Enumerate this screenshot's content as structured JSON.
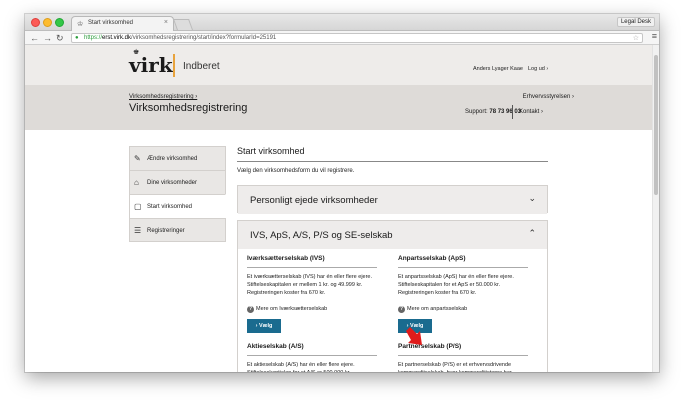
{
  "browser": {
    "tab_title": "Start virksomhed",
    "profile": "Legal Desk",
    "url_https": "https://",
    "url_host": "erst.virk.dk",
    "url_path": "/virksomhedsregistrering/start/index?formularId=25191"
  },
  "header": {
    "logo": "virk",
    "section": "Indberet",
    "user": "Anders Lyager Kaae",
    "logout": "Log ud ›"
  },
  "subheader": {
    "breadcrumb": "Virksomhedsregistrering ›",
    "title": "Virksomhedsregistrering",
    "agency": "Erhvervsstyrelsen ›",
    "support_label": "Support:",
    "support_phone": "78 73 96 03",
    "contact": "Kontakt ›"
  },
  "sidebar": {
    "items": [
      {
        "label": "Ændre virksomhed",
        "icon": "edit-icon"
      },
      {
        "label": "Dine virksomheder",
        "icon": "factory-icon"
      },
      {
        "label": "Start virksomhed",
        "icon": "new-document-icon"
      },
      {
        "label": "Registreringer",
        "icon": "list-icon"
      }
    ]
  },
  "content": {
    "title": "Start virksomhed",
    "subtitle": "Vælg den virksomhedsform du vil registrere.",
    "sections": [
      {
        "title": "Personligt ejede virksomheder",
        "expanded": false
      },
      {
        "title": "IVS, ApS, A/S, P/S og SE-selskab",
        "expanded": true
      }
    ],
    "cards": [
      {
        "title": "Iværksætterselskab (IVS)",
        "text": "Et iværksætterselskab (IVS) har én eller flere ejere. Stiftelseskapitalen er mellem 1 kr. og 49.999 kr. Registreringen koster fra 670 kr.",
        "more": "Mere om Iværksætterselskab",
        "button": "› Vælg"
      },
      {
        "title": "Anpartsselskab (ApS)",
        "text": "Et anpartsselskab (ApS) har én eller flere ejere. Stiftelseskapitalen for et ApS er 50.000 kr. Registreringen koster fra 670 kr.",
        "more": "Mere om anpartsselskab",
        "button": "› Vælg"
      },
      {
        "title": "Aktieselskab (A/S)",
        "text": "Et aktieselskab (A/S) har én eller flere ejere. Stiftelseskapitalen for et A/S er 500.000 kr."
      },
      {
        "title": "Partnerselskab (P/S)",
        "text": "Et partnerselskab (P/S) er et erhvervsdrivende kommanditselskab, hvor kommanditisterne har"
      }
    ]
  },
  "colors": {
    "accent": "#1a6b8f",
    "logo_bar": "#e8a33d",
    "annotation_arrow": "#e01b1b"
  }
}
